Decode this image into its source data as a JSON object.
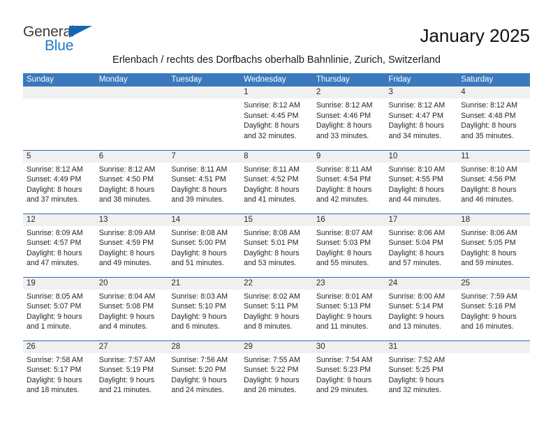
{
  "brand": {
    "name_part1": "General",
    "name_part2": "Blue",
    "triangle_color": "#1267b0",
    "blue_color": "#1b79c8"
  },
  "header": {
    "title": "January 2025",
    "location": "Erlenbach / rechts des Dorfbachs oberhalb Bahnlinie, Zurich, Switzerland",
    "header_bg_color": "#3a79bd",
    "row_separator_color": "#2a6db5",
    "daynum_strip_color": "#f0f0f0"
  },
  "weekday_headers": [
    "Sunday",
    "Monday",
    "Tuesday",
    "Wednesday",
    "Thursday",
    "Friday",
    "Saturday"
  ],
  "weeks": [
    [
      {
        "day": "",
        "lines": []
      },
      {
        "day": "",
        "lines": []
      },
      {
        "day": "",
        "lines": []
      },
      {
        "day": "1",
        "lines": [
          "Sunrise: 8:12 AM",
          "Sunset: 4:45 PM",
          "Daylight: 8 hours",
          "and 32 minutes."
        ]
      },
      {
        "day": "2",
        "lines": [
          "Sunrise: 8:12 AM",
          "Sunset: 4:46 PM",
          "Daylight: 8 hours",
          "and 33 minutes."
        ]
      },
      {
        "day": "3",
        "lines": [
          "Sunrise: 8:12 AM",
          "Sunset: 4:47 PM",
          "Daylight: 8 hours",
          "and 34 minutes."
        ]
      },
      {
        "day": "4",
        "lines": [
          "Sunrise: 8:12 AM",
          "Sunset: 4:48 PM",
          "Daylight: 8 hours",
          "and 35 minutes."
        ]
      }
    ],
    [
      {
        "day": "5",
        "lines": [
          "Sunrise: 8:12 AM",
          "Sunset: 4:49 PM",
          "Daylight: 8 hours",
          "and 37 minutes."
        ]
      },
      {
        "day": "6",
        "lines": [
          "Sunrise: 8:12 AM",
          "Sunset: 4:50 PM",
          "Daylight: 8 hours",
          "and 38 minutes."
        ]
      },
      {
        "day": "7",
        "lines": [
          "Sunrise: 8:11 AM",
          "Sunset: 4:51 PM",
          "Daylight: 8 hours",
          "and 39 minutes."
        ]
      },
      {
        "day": "8",
        "lines": [
          "Sunrise: 8:11 AM",
          "Sunset: 4:52 PM",
          "Daylight: 8 hours",
          "and 41 minutes."
        ]
      },
      {
        "day": "9",
        "lines": [
          "Sunrise: 8:11 AM",
          "Sunset: 4:54 PM",
          "Daylight: 8 hours",
          "and 42 minutes."
        ]
      },
      {
        "day": "10",
        "lines": [
          "Sunrise: 8:10 AM",
          "Sunset: 4:55 PM",
          "Daylight: 8 hours",
          "and 44 minutes."
        ]
      },
      {
        "day": "11",
        "lines": [
          "Sunrise: 8:10 AM",
          "Sunset: 4:56 PM",
          "Daylight: 8 hours",
          "and 46 minutes."
        ]
      }
    ],
    [
      {
        "day": "12",
        "lines": [
          "Sunrise: 8:09 AM",
          "Sunset: 4:57 PM",
          "Daylight: 8 hours",
          "and 47 minutes."
        ]
      },
      {
        "day": "13",
        "lines": [
          "Sunrise: 8:09 AM",
          "Sunset: 4:59 PM",
          "Daylight: 8 hours",
          "and 49 minutes."
        ]
      },
      {
        "day": "14",
        "lines": [
          "Sunrise: 8:08 AM",
          "Sunset: 5:00 PM",
          "Daylight: 8 hours",
          "and 51 minutes."
        ]
      },
      {
        "day": "15",
        "lines": [
          "Sunrise: 8:08 AM",
          "Sunset: 5:01 PM",
          "Daylight: 8 hours",
          "and 53 minutes."
        ]
      },
      {
        "day": "16",
        "lines": [
          "Sunrise: 8:07 AM",
          "Sunset: 5:03 PM",
          "Daylight: 8 hours",
          "and 55 minutes."
        ]
      },
      {
        "day": "17",
        "lines": [
          "Sunrise: 8:06 AM",
          "Sunset: 5:04 PM",
          "Daylight: 8 hours",
          "and 57 minutes."
        ]
      },
      {
        "day": "18",
        "lines": [
          "Sunrise: 8:06 AM",
          "Sunset: 5:05 PM",
          "Daylight: 8 hours",
          "and 59 minutes."
        ]
      }
    ],
    [
      {
        "day": "19",
        "lines": [
          "Sunrise: 8:05 AM",
          "Sunset: 5:07 PM",
          "Daylight: 9 hours",
          "and 1 minute."
        ]
      },
      {
        "day": "20",
        "lines": [
          "Sunrise: 8:04 AM",
          "Sunset: 5:08 PM",
          "Daylight: 9 hours",
          "and 4 minutes."
        ]
      },
      {
        "day": "21",
        "lines": [
          "Sunrise: 8:03 AM",
          "Sunset: 5:10 PM",
          "Daylight: 9 hours",
          "and 6 minutes."
        ]
      },
      {
        "day": "22",
        "lines": [
          "Sunrise: 8:02 AM",
          "Sunset: 5:11 PM",
          "Daylight: 9 hours",
          "and 8 minutes."
        ]
      },
      {
        "day": "23",
        "lines": [
          "Sunrise: 8:01 AM",
          "Sunset: 5:13 PM",
          "Daylight: 9 hours",
          "and 11 minutes."
        ]
      },
      {
        "day": "24",
        "lines": [
          "Sunrise: 8:00 AM",
          "Sunset: 5:14 PM",
          "Daylight: 9 hours",
          "and 13 minutes."
        ]
      },
      {
        "day": "25",
        "lines": [
          "Sunrise: 7:59 AM",
          "Sunset: 5:16 PM",
          "Daylight: 9 hours",
          "and 16 minutes."
        ]
      }
    ],
    [
      {
        "day": "26",
        "lines": [
          "Sunrise: 7:58 AM",
          "Sunset: 5:17 PM",
          "Daylight: 9 hours",
          "and 18 minutes."
        ]
      },
      {
        "day": "27",
        "lines": [
          "Sunrise: 7:57 AM",
          "Sunset: 5:19 PM",
          "Daylight: 9 hours",
          "and 21 minutes."
        ]
      },
      {
        "day": "28",
        "lines": [
          "Sunrise: 7:56 AM",
          "Sunset: 5:20 PM",
          "Daylight: 9 hours",
          "and 24 minutes."
        ]
      },
      {
        "day": "29",
        "lines": [
          "Sunrise: 7:55 AM",
          "Sunset: 5:22 PM",
          "Daylight: 9 hours",
          "and 26 minutes."
        ]
      },
      {
        "day": "30",
        "lines": [
          "Sunrise: 7:54 AM",
          "Sunset: 5:23 PM",
          "Daylight: 9 hours",
          "and 29 minutes."
        ]
      },
      {
        "day": "31",
        "lines": [
          "Sunrise: 7:52 AM",
          "Sunset: 5:25 PM",
          "Daylight: 9 hours",
          "and 32 minutes."
        ]
      },
      {
        "day": "",
        "lines": []
      }
    ]
  ]
}
